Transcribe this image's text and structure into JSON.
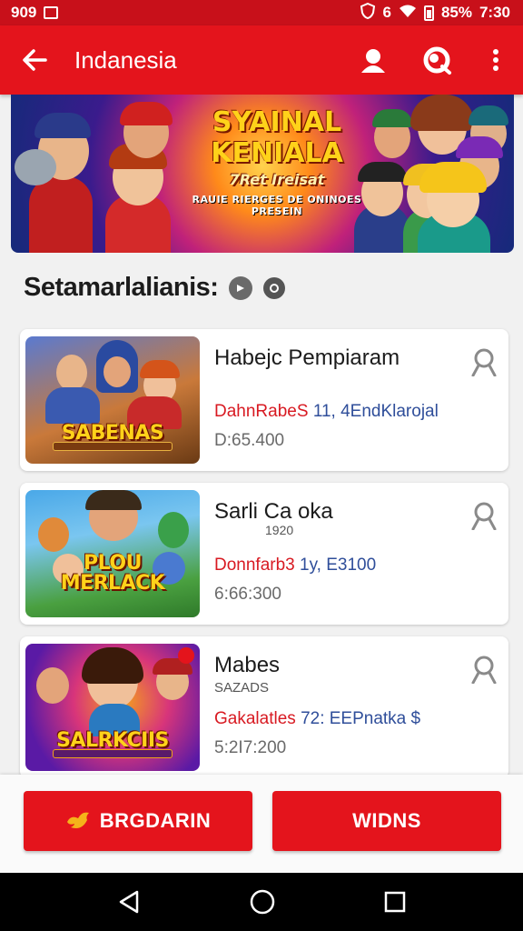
{
  "status_bar": {
    "left_text": "909",
    "signal_text": "6",
    "battery": "85%",
    "time": "7:30"
  },
  "app_bar": {
    "title": "Indanesia",
    "icons": [
      "back-arrow-icon",
      "profile-icon",
      "sync-icon",
      "more-vert-icon"
    ]
  },
  "banner": {
    "line1": "SYAINAL",
    "line2": "KENIALA",
    "line3": "7Ret Ireisat",
    "line4": "RAUIE RIERGES DE ONINOES PRESEIN"
  },
  "section": {
    "title": "Setamarlalianis:"
  },
  "games": [
    {
      "name": "Habejc Pempiaram",
      "subtitle": "",
      "price_red": "DahnRabeS",
      "price_blue": "11, 4EndKlarojal",
      "meta": "D:65.400",
      "thumb_logo": "SABENAS",
      "colors": [
        "#d65a1e",
        "#4b73c9",
        "#7a4a1a"
      ]
    },
    {
      "name": "Sarli Ca oka",
      "subtitle": "1920",
      "price_red": "Donnfarb3",
      "price_blue": "1y, E3100",
      "meta": "6:66:300",
      "thumb_logo": "PLOU MERLACK",
      "colors": [
        "#3aa0e0",
        "#5abb3a",
        "#e2921a"
      ]
    },
    {
      "name": "Mabes",
      "subtitle": "SAZADS",
      "price_red": "Gakalatles",
      "price_blue": "72: EEPnatka $",
      "meta": "5:2I7:200",
      "thumb_logo": "SALRKCIIS",
      "colors": [
        "#7a2ab5",
        "#d8357a",
        "#f0a21a"
      ]
    }
  ],
  "actions": {
    "left_label": "BRGDARIN",
    "right_label": "WIDNS"
  },
  "colors": {
    "primary": "#e4141c",
    "status": "#c8101a",
    "price_red": "#d81a22",
    "price_blue": "#2f4e9a"
  }
}
